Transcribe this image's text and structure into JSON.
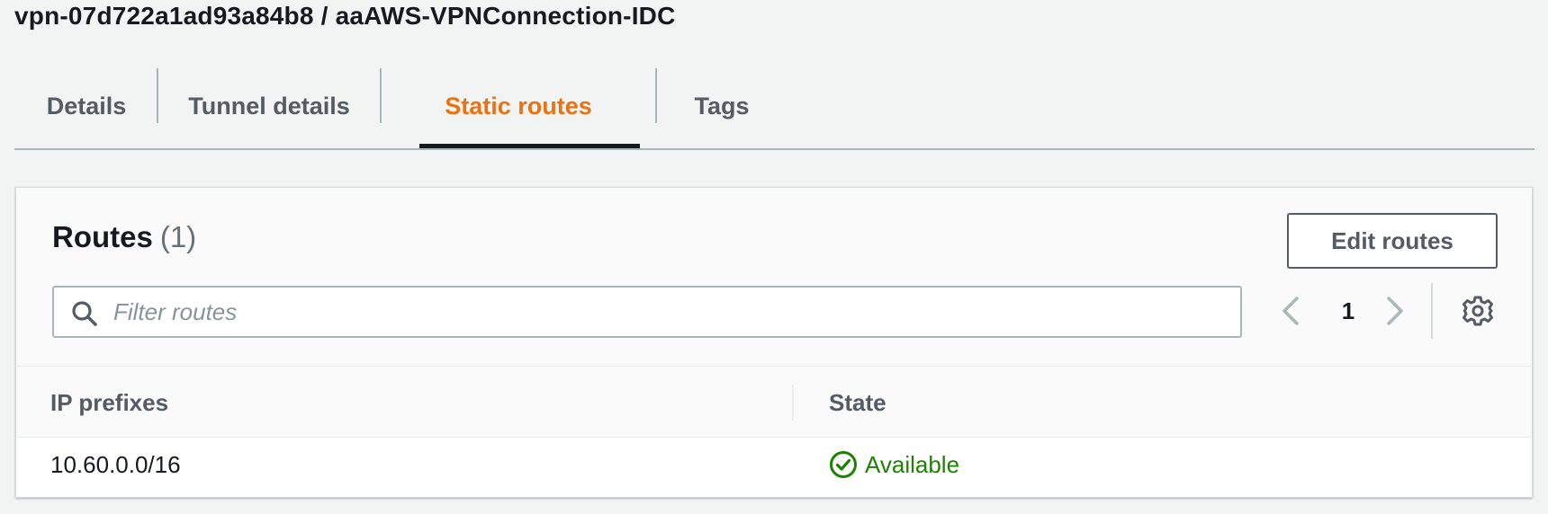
{
  "header": {
    "title": "vpn-07d722a1ad93a84b8 / aaAWS-VPNConnection-IDC"
  },
  "tabs": [
    {
      "label": "Details",
      "active": false
    },
    {
      "label": "Tunnel details",
      "active": false
    },
    {
      "label": "Static routes",
      "active": true
    },
    {
      "label": "Tags",
      "active": false
    }
  ],
  "routes_panel": {
    "title": "Routes",
    "count": "(1)",
    "edit_button": "Edit routes",
    "filter_placeholder": "Filter routes",
    "filter_value": "",
    "page": "1",
    "columns": [
      "IP prefixes",
      "State"
    ],
    "rows": [
      {
        "ip_prefix": "10.60.0.0/16",
        "state": "Available"
      }
    ]
  },
  "icons": {
    "search": "search-icon",
    "prev": "chevron-left-icon",
    "next": "chevron-right-icon",
    "settings": "gear-icon",
    "status": "check-circle-icon"
  },
  "colors": {
    "active_tab": "#ec7211",
    "status_ok": "#1d8102",
    "background": "#f2f3f3"
  }
}
